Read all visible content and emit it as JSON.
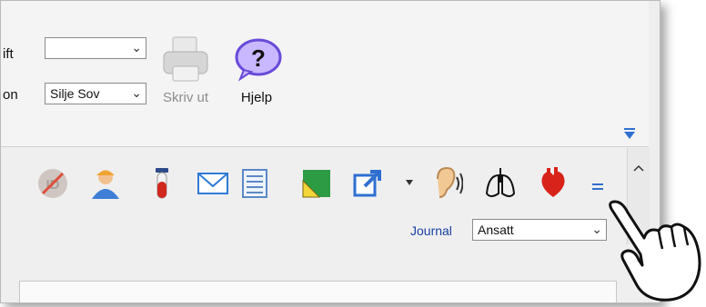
{
  "ribbon": {
    "label1": "ift",
    "combo1_value": "",
    "label2": "on",
    "combo2_value": "Silje Sov",
    "print_label": "Skriv ut",
    "help_label": "Hjelp"
  },
  "toolbar": {
    "journal_label": "Journal",
    "journal_value": "Ansatt",
    "icons": [
      "id-disabled-icon",
      "person-icon",
      "test-tube-icon",
      "envelope-icon",
      "document-list-icon",
      "green-ruler-icon",
      "external-link-icon",
      "ear-icon",
      "lungs-icon",
      "heart-icon",
      "more-icon"
    ]
  },
  "colors": {
    "link_blue": "#1a3fa0",
    "accent": "#2f6fd1"
  }
}
